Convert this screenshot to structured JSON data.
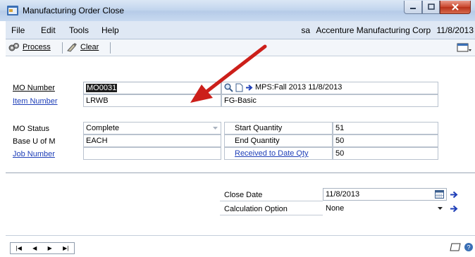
{
  "window": {
    "title": "Manufacturing Order Close"
  },
  "menu": {
    "items": [
      "File",
      "Edit",
      "Tools",
      "Help"
    ],
    "user": "sa",
    "company": "Accenture Manufacturing Corp",
    "date": "11/8/2013"
  },
  "toolbar": {
    "process_label": "Process",
    "clear_label": "Clear"
  },
  "form": {
    "mo_number": {
      "label": "MO Number",
      "value": "MO0031",
      "mps_text": "MPS:Fall 2013 11/8/2013"
    },
    "item_number": {
      "label": "Item Number",
      "value": "LRWB",
      "description": "FG-Basic"
    },
    "mo_status": {
      "label": "MO Status",
      "value": "Complete"
    },
    "base_uom": {
      "label": "Base U of M",
      "value": "EACH"
    },
    "job_number": {
      "label": "Job Number",
      "value": ""
    },
    "start_quantity": {
      "label": "Start Quantity",
      "value": "51"
    },
    "end_quantity": {
      "label": "End Quantity",
      "value": "50"
    },
    "received_to_date": {
      "label": "Received to Date Qty",
      "value": "50"
    },
    "close_date": {
      "label": "Close Date",
      "value": "11/8/2013"
    },
    "calculation_option": {
      "label": "Calculation Option",
      "value": "None"
    }
  },
  "colors": {
    "link": "#1f3fb8",
    "annotation_arrow": "#cc1f1a",
    "titlebar": "#c3d6ee"
  },
  "icons": [
    "app-icon",
    "process-icon",
    "clear-icon",
    "lookup-icon",
    "new-note-icon",
    "go-arrow-icon",
    "calendar-icon",
    "dropdown-icon",
    "nav-first-icon",
    "nav-prev-icon",
    "nav-next-icon",
    "nav-last-icon",
    "note-icon",
    "help-icon",
    "layout-icon"
  ]
}
